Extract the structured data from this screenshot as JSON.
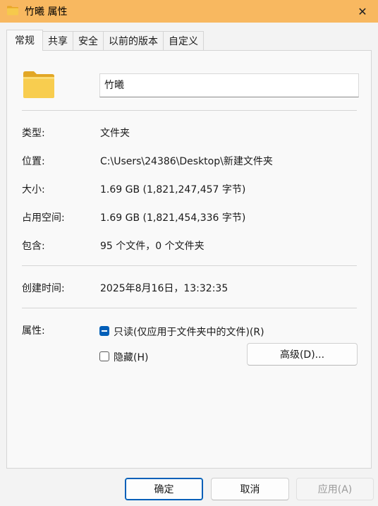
{
  "window": {
    "title": "竹曦 属性",
    "close_glyph": "✕",
    "titlebar_color": "#f8b860",
    "icon": "folder-icon"
  },
  "tabs": [
    {
      "label": "常规",
      "active": true
    },
    {
      "label": "共享",
      "active": false
    },
    {
      "label": "安全",
      "active": false
    },
    {
      "label": "以前的版本",
      "active": false
    },
    {
      "label": "自定义",
      "active": false
    }
  ],
  "general": {
    "folder_name": "竹曦",
    "type": {
      "label": "类型:",
      "value": "文件夹"
    },
    "location": {
      "label": "位置:",
      "value": "C:\\Users\\24386\\Desktop\\新建文件夹"
    },
    "size": {
      "label": "大小:",
      "value": "1.69 GB (1,821,247,457 字节)"
    },
    "size_on_disk": {
      "label": "占用空间:",
      "value": "1.69 GB (1,821,454,336 字节)"
    },
    "contains": {
      "label": "包含:",
      "value": "95 个文件，0 个文件夹"
    },
    "created": {
      "label": "创建时间:",
      "value": "2025年8月16日，13:32:35"
    },
    "attributes": {
      "label": "属性:",
      "readonly_label": "只读(仅应用于文件夹中的文件)(R)",
      "readonly_state": "indeterminate",
      "hidden_label": "隐藏(H)",
      "hidden_checked": false,
      "advanced_label": "高级(D)..."
    }
  },
  "footer": {
    "ok_label": "确定",
    "cancel_label": "取消",
    "apply_label": "应用(A)",
    "apply_enabled": false
  },
  "colors": {
    "accent": "#005fb8",
    "folder": "#f5c542"
  }
}
